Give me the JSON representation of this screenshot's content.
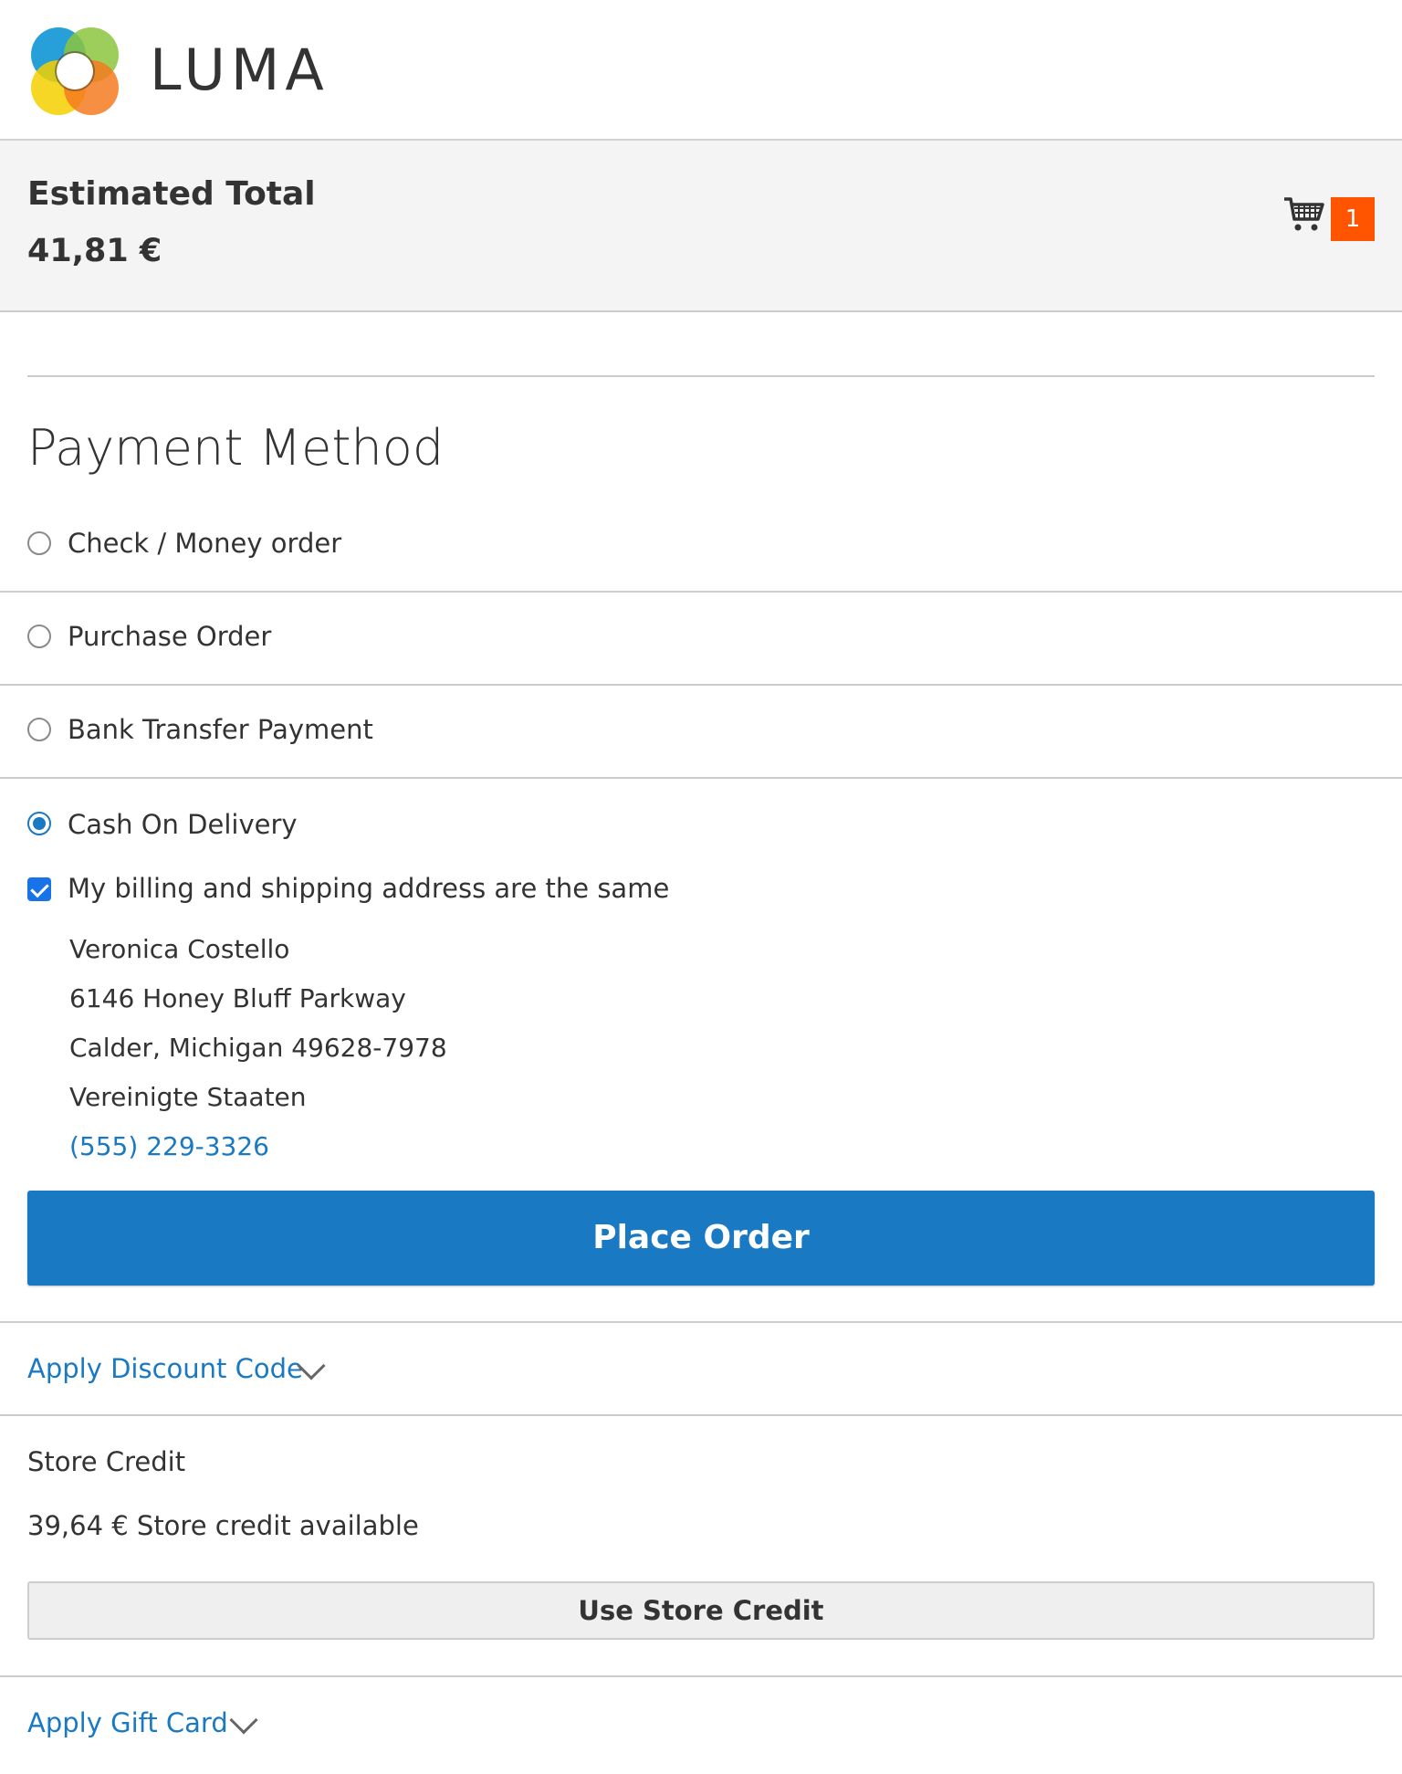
{
  "brand": {
    "name": "LUMA",
    "colors": {
      "blue": "#1b9ad6",
      "green": "#8cc63e",
      "yellow": "#f4d000",
      "orange": "#f47b20"
    }
  },
  "summary": {
    "title": "Estimated Total",
    "amount": "41,81 €",
    "cart_icon": "shopping-cart-icon",
    "cart_count": "1"
  },
  "payment": {
    "title": "Payment Method",
    "methods": [
      {
        "label": "Check / Money order",
        "selected": false
      },
      {
        "label": "Purchase Order",
        "selected": false
      },
      {
        "label": "Bank Transfer Payment",
        "selected": false
      },
      {
        "label": "Cash On Delivery",
        "selected": true
      }
    ],
    "same_address_label": "My billing and shipping address are the same",
    "same_address_checked": true,
    "address": {
      "name": "Veronica Costello",
      "street": "6146 Honey Bluff Parkway",
      "city_line": "Calder, Michigan 49628-7978",
      "country": "Vereinigte Staaten",
      "phone": "(555) 229-3326"
    },
    "place_order_label": "Place Order"
  },
  "discount": {
    "label": "Apply Discount Code"
  },
  "store_credit": {
    "title": "Store Credit",
    "available": "39,64 € Store credit available",
    "button_label": "Use Store Credit"
  },
  "gift_card": {
    "label": "Apply Gift Card"
  },
  "colors": {
    "primary": "#1979c3",
    "badge": "#ff5501",
    "text": "#333333"
  }
}
